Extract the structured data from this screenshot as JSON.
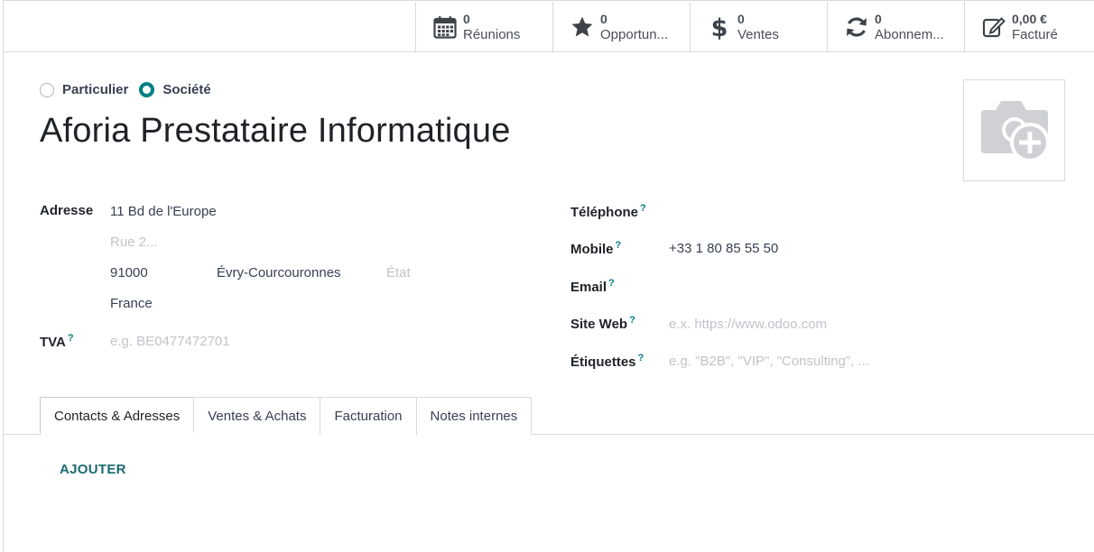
{
  "smart_buttons": [
    {
      "icon": "calendar-icon",
      "value": "0",
      "label": "Réunions"
    },
    {
      "icon": "star-icon",
      "value": "0",
      "label": "Opportun..."
    },
    {
      "icon": "dollar-icon",
      "value": "0",
      "label": "Ventes"
    },
    {
      "icon": "refresh-icon",
      "value": "0",
      "label": "Abonnem..."
    },
    {
      "icon": "edit-icon",
      "value": "0,00 €",
      "label": "Facturé"
    }
  ],
  "partner_type": {
    "options": [
      "Particulier",
      "Société"
    ],
    "selected": "Société"
  },
  "company_name": "Aforia Prestataire Informatique",
  "address": {
    "label": "Adresse",
    "street": "11 Bd de l'Europe",
    "street2_placeholder": "Rue 2...",
    "zip": "91000",
    "city": "Évry-Courcouronnes",
    "state_placeholder": "État",
    "country": "France"
  },
  "vat": {
    "label": "TVA",
    "help": "?",
    "placeholder": "e.g. BE0477472701"
  },
  "phone": {
    "label": "Téléphone",
    "help": "?",
    "value": ""
  },
  "mobile": {
    "label": "Mobile",
    "help": "?",
    "value": "+33 1 80 85 55 50"
  },
  "email": {
    "label": "Email",
    "help": "?",
    "value": ""
  },
  "website": {
    "label": "Site Web",
    "help": "?",
    "placeholder": "e.x. https://www.odoo.com"
  },
  "tags": {
    "label": "Étiquettes",
    "help": "?",
    "placeholder": "e.g. \"B2B\", \"VIP\", \"Consulting\", ..."
  },
  "tabs": [
    {
      "label": "Contacts & Adresses",
      "active": true
    },
    {
      "label": "Ventes & Achats",
      "active": false
    },
    {
      "label": "Facturation",
      "active": false
    },
    {
      "label": "Notes internes",
      "active": false
    }
  ],
  "add_button": "AJOUTER",
  "colors": {
    "accent": "#017e84",
    "link": "#1b6b70",
    "border": "#d8dadd",
    "placeholder": "#c0c4c9"
  }
}
